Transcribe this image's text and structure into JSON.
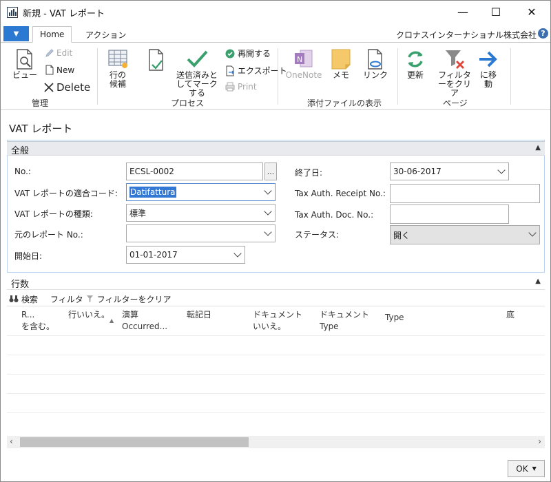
{
  "window": {
    "title": "新規 - VAT レポート",
    "minimize": "—",
    "maximize": "☐",
    "close": "✕"
  },
  "ribbon_tabs": {
    "file": "▼",
    "home": "Home",
    "action": "アクション",
    "company": "クロナスインターナショナル株式会社",
    "help": "?"
  },
  "ribbon": {
    "manage": {
      "label": "管理",
      "view": "ビュー",
      "edit": "Edit",
      "new": "New",
      "delete": "Delete"
    },
    "process": {
      "label": "プロセス",
      "suggest_lines": "行の\n候補",
      "release": "",
      "mark_submitted": "送信済みと\nしてマークする",
      "reopen": "再開する",
      "export": "エクスポート",
      "print": "Print"
    },
    "attachments": {
      "label": "添付ファイルの表示",
      "onenote": "OneNote",
      "memo": "メモ",
      "link": "リンク"
    },
    "page": {
      "label": "ページ",
      "refresh": "更新",
      "clear_filter": "フィルタ\nーをクリア",
      "goto": "に移\n動"
    }
  },
  "page_title": "VAT レポート",
  "general": {
    "header": "全般",
    "no_label": "No.:",
    "no_value": "ECSL-0002",
    "no_lookup": "...",
    "config_label": "VAT レポートの適合コード:",
    "config_value": "Datifattura",
    "type_label": "VAT レポートの種類:",
    "type_value": "標準",
    "orig_label": "元のレポート No.:",
    "orig_value": "",
    "start_label": "開始日:",
    "start_value": "01-01-2017",
    "end_label": "終了日:",
    "end_value": "30-06-2017",
    "receipt_label": "Tax Auth. Receipt No.:",
    "receipt_value": "",
    "doc_label": "Tax Auth. Doc. No.:",
    "doc_value": "",
    "status_label": "ステータス:",
    "status_value": "開く"
  },
  "lines": {
    "header": "行数",
    "search": "検索",
    "filter": "フィルタ",
    "clear_filter": "フィルターをクリア",
    "columns": [
      "R...\nを含む。",
      "行いいえ。",
      "演算\nOccurred...",
      "転記日",
      "ドキュメント\nいいえ。",
      "ドキュメント\nType",
      "Type",
      "底"
    ]
  },
  "footer": {
    "ok": "OK"
  }
}
